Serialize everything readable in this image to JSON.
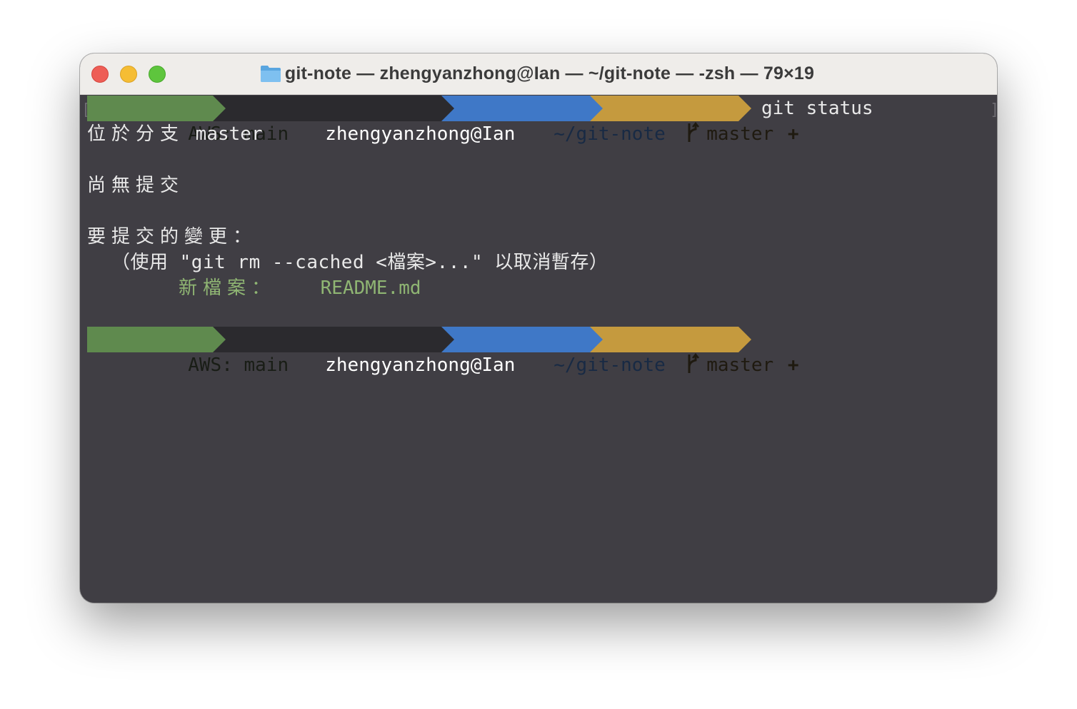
{
  "window": {
    "title": "git-note — zhengyanzhong@Ian — ~/git-note — -zsh — 79×19",
    "folder_icon": "folder-icon",
    "traffic_lights": {
      "close_color": "#ee5e56",
      "minimize_color": "#f5bd34",
      "zoom_color": "#5ec53d"
    }
  },
  "prompt": {
    "aws": "AWS: main",
    "user": "zhengyanzhong@Ian",
    "dir": "~/git-note",
    "branch": "master",
    "dirty": "+",
    "branch_icon": "git-branch-icon",
    "colors": {
      "aws": "#5f8a4e",
      "user": "#2b2a2e",
      "dir": "#3f78c7",
      "git": "#c59a3e"
    }
  },
  "command": "git status",
  "brackets": {
    "open": "[",
    "close": "]"
  },
  "output": {
    "on_branch_label": "位於分支",
    "on_branch_name": "master",
    "no_commits": "尚無提交",
    "changes_header": "要提交的變更：",
    "hint": "（使用 \"git rm --cached <檔案>...\" 以取消暫存）",
    "new_file_label": "新檔案：",
    "new_file_name": "README.md"
  },
  "terminal_background": "#403e44"
}
